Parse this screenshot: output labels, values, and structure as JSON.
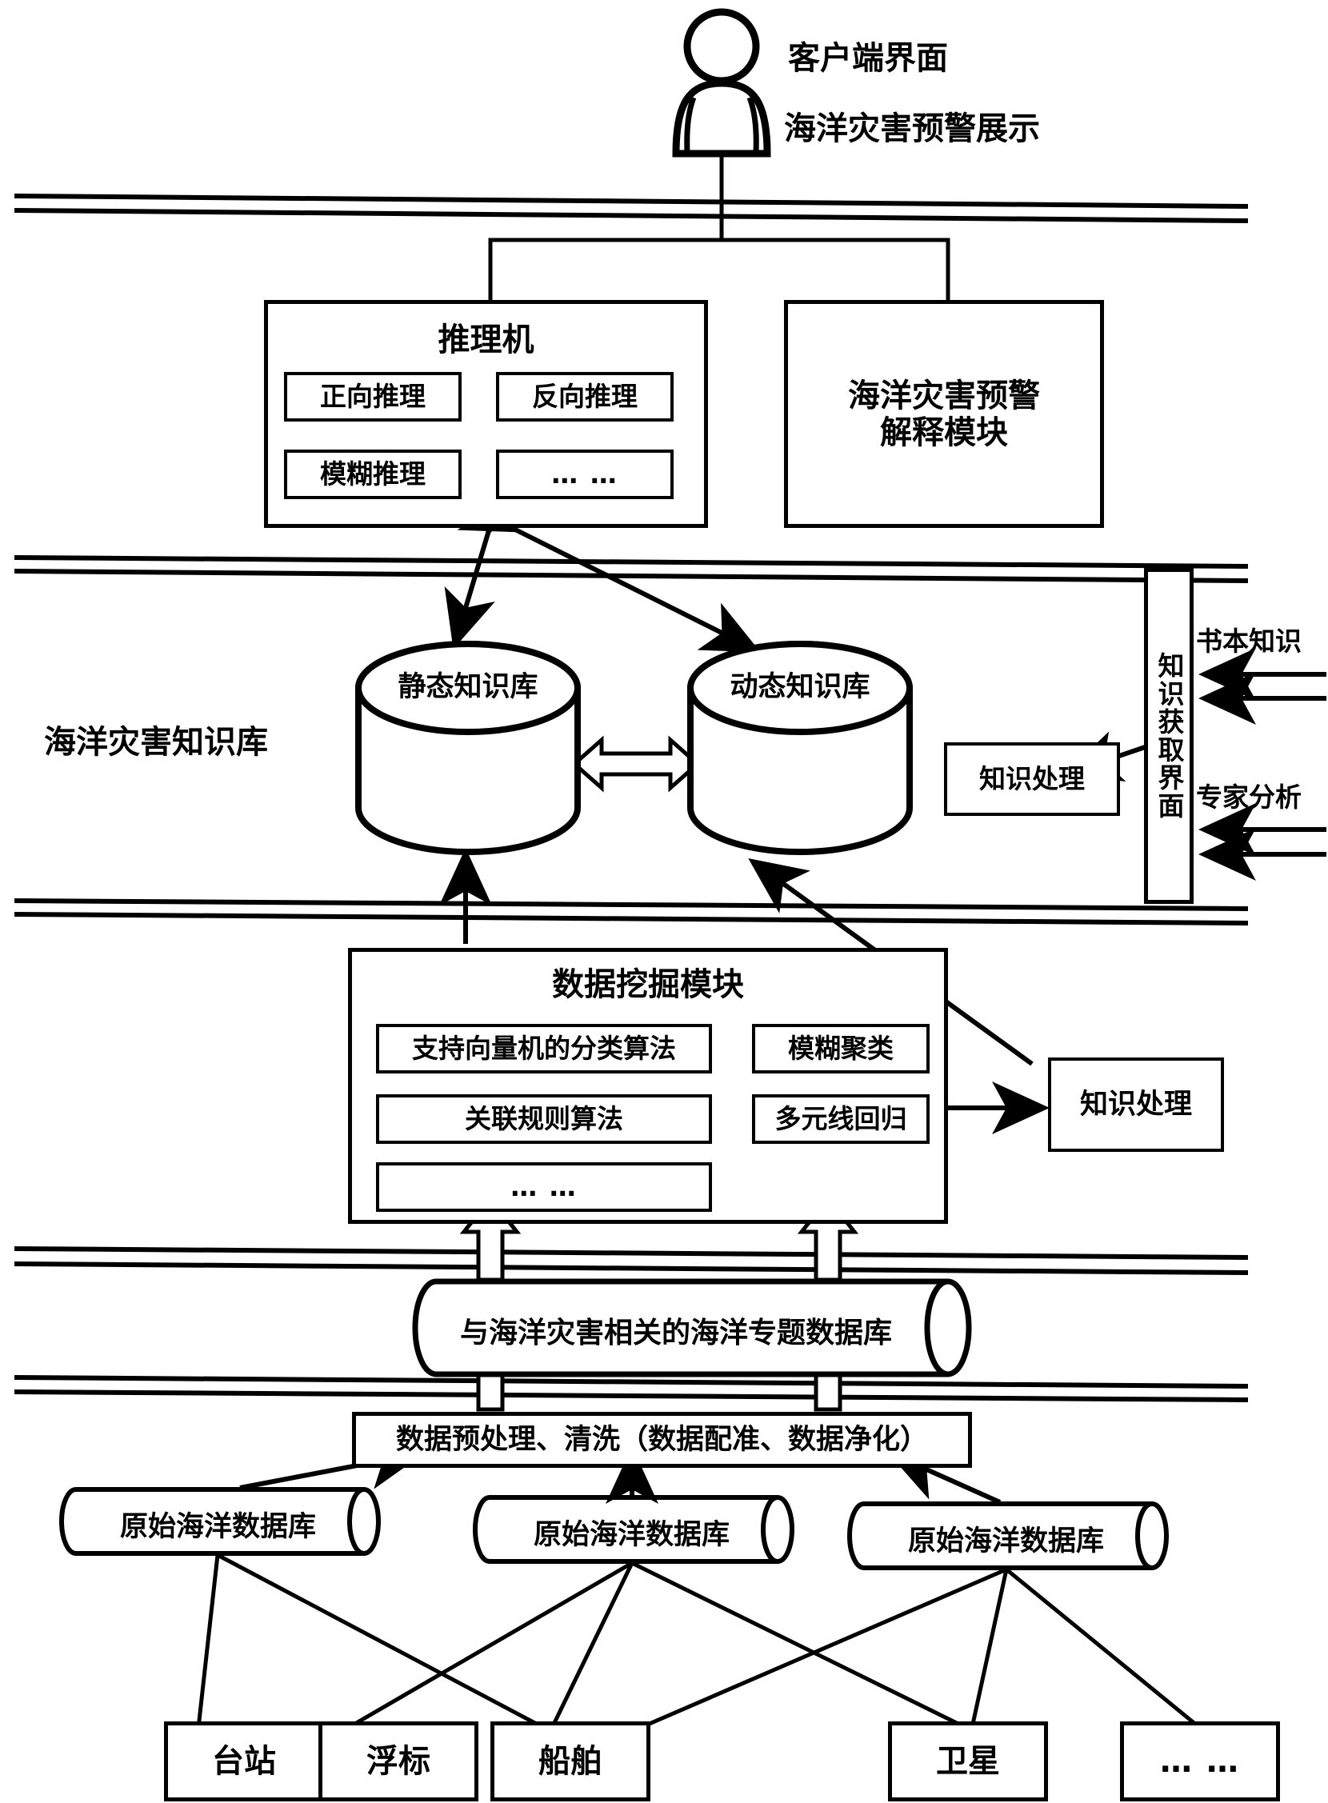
{
  "diagram": {
    "title_client": {
      "line1": "客户端界面",
      "line2": "海洋灾害预警展示"
    },
    "layer_labels": {
      "knowledge_base": "海洋灾害知识库"
    },
    "inference_engine": {
      "title": "推理机",
      "items": [
        "正向推理",
        "反向推理",
        "模糊推理",
        "… …"
      ]
    },
    "explanation_module": {
      "line1": "海洋灾害预警",
      "line2": "解释模块"
    },
    "knowledge_bases": {
      "static": "静态知识库",
      "dynamic": "动态知识库"
    },
    "knowledge_processing_right": "知识处理",
    "knowledge_processing_mining": "知识处理",
    "acquisition_interface": "知识获取界面",
    "external_sources": {
      "books": "书本知识",
      "experts": "专家分析"
    },
    "mining_module": {
      "title": "数据挖掘模块",
      "left_items": [
        "支持向量机的分类算法",
        "关联规则算法",
        "… …"
      ],
      "right_items": [
        "模糊聚类",
        "多元线回归"
      ]
    },
    "thematic_db": "与海洋灾害相关的海洋专题数据库",
    "preprocess": "数据预处理、清洗（数据配准、数据净化）",
    "raw_dbs": [
      "原始海洋数据库",
      "原始海洋数据库",
      "原始海洋数据库"
    ],
    "sources": [
      "台站",
      "浮标",
      "船舶",
      "卫星",
      "… …"
    ],
    "icons": {
      "user": "user-person-icon"
    },
    "colors": {
      "stroke": "#000000",
      "background": "#ffffff"
    }
  }
}
